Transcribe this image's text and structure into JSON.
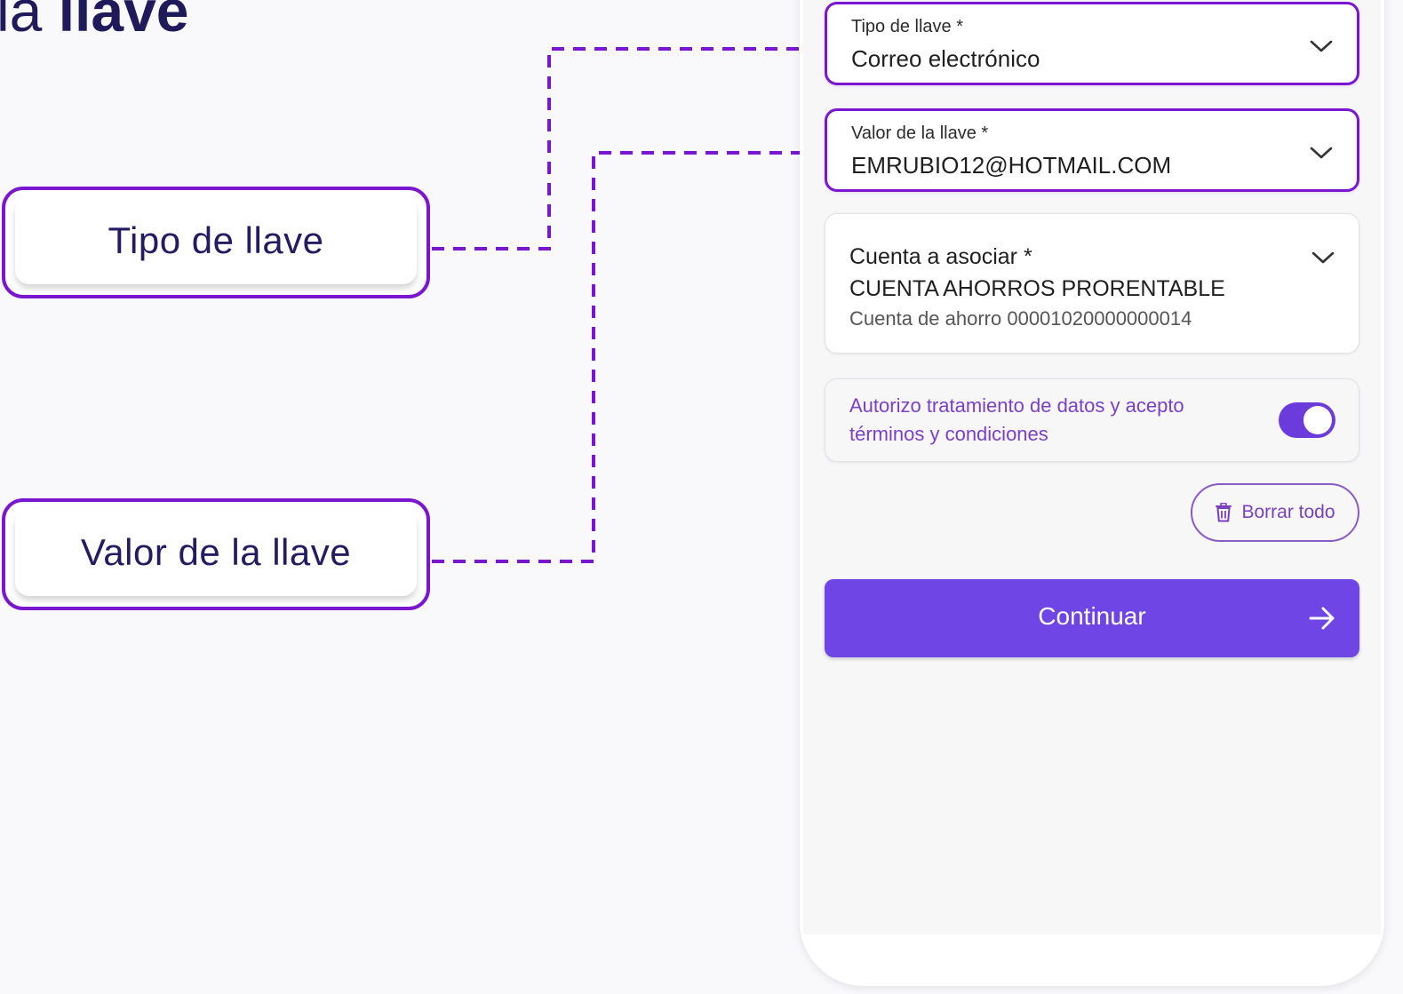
{
  "heading": {
    "prefix": "la",
    "emphasis": "llave"
  },
  "callouts": [
    {
      "label": "Tipo de llave"
    },
    {
      "label": "Valor de la llave"
    }
  ],
  "colors": {
    "accent": "#7a16cf",
    "primary_button": "#6f45e6",
    "toggle_on": "#6c3bdc",
    "callout_text": "#231c63"
  },
  "form": {
    "tipo": {
      "label": "Tipo de llave *",
      "value": "Correo electrónico",
      "icon": "chevron-down-icon"
    },
    "valor": {
      "label": "Valor de la llave *",
      "value": "EMRUBIO12@HOTMAIL.COM",
      "icon": "chevron-down-icon"
    },
    "cuenta": {
      "label": "Cuenta a asociar *",
      "value": "CUENTA AHORROS PRORENTABLE",
      "sub": "Cuenta de ahorro 00001020000000014",
      "icon": "chevron-down-icon"
    },
    "terms": {
      "text": "Autorizo tratamiento de datos y acepto términos y condiciones",
      "enabled": true
    },
    "clear_button": {
      "label": "Borrar todo",
      "icon": "trash-icon"
    },
    "continue_button": {
      "label": "Continuar",
      "icon": "arrow-right-icon"
    }
  }
}
